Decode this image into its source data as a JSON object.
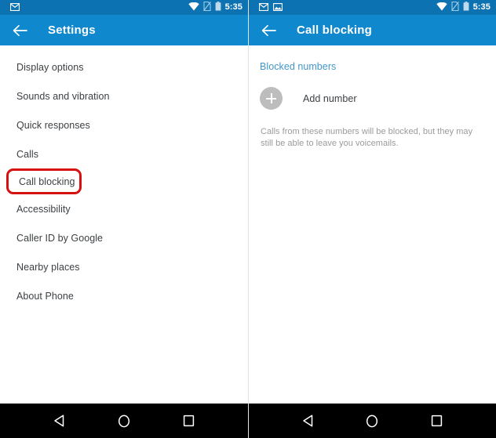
{
  "colors": {
    "status_bar": "#0c72b1",
    "app_bar": "#0f88ce",
    "accent_link": "#4396c8",
    "highlight_box": "#d7110f",
    "add_circle": "#bdbdbd",
    "nav_bar": "#000000",
    "body_text": "#3c4043",
    "hint_text": "#9b9b9b"
  },
  "left_screen": {
    "status": {
      "time": "5:35",
      "left_icons": [
        "gmail-icon"
      ],
      "right_icons": [
        "wifi-icon",
        "no-sim-icon",
        "battery-icon"
      ]
    },
    "app_bar": {
      "back_icon": "back-arrow-icon",
      "title": "Settings"
    },
    "items": [
      {
        "label": "Display options",
        "highlighted": false
      },
      {
        "label": "Sounds and vibration",
        "highlighted": false
      },
      {
        "label": "Quick responses",
        "highlighted": false
      },
      {
        "label": "Calls",
        "highlighted": false
      },
      {
        "label": "Call blocking",
        "highlighted": true
      },
      {
        "label": "Accessibility",
        "highlighted": false
      },
      {
        "label": "Caller ID by Google",
        "highlighted": false
      },
      {
        "label": "Nearby places",
        "highlighted": false
      },
      {
        "label": "About Phone",
        "highlighted": false
      }
    ],
    "nav": {
      "back": "triangle-back-icon",
      "home": "circle-home-icon",
      "recents": "square-recents-icon"
    }
  },
  "right_screen": {
    "status": {
      "time": "5:35",
      "left_icons": [
        "gmail-icon",
        "screenshot-icon"
      ],
      "right_icons": [
        "wifi-icon",
        "no-sim-icon",
        "battery-icon"
      ]
    },
    "app_bar": {
      "back_icon": "back-arrow-icon",
      "title": "Call blocking"
    },
    "section_link": "Blocked numbers",
    "add_number_label": "Add number",
    "hint": "Calls from these numbers will be blocked, but they may still be able to leave you voicemails.",
    "nav": {
      "back": "triangle-back-icon",
      "home": "circle-home-icon",
      "recents": "square-recents-icon"
    }
  }
}
